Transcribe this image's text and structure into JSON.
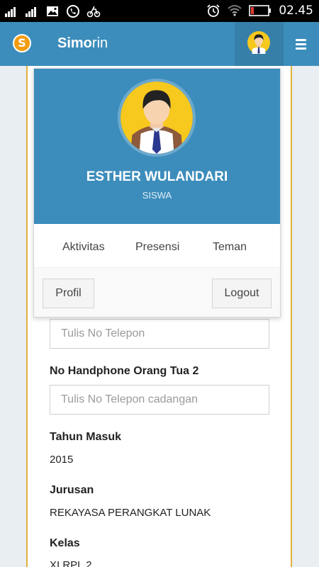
{
  "status_bar": {
    "icons": [
      "signal-icon",
      "signal-2-icon",
      "image-icon",
      "whatsapp-icon",
      "bike-icon",
      "alarm-icon",
      "wifi-icon",
      "battery-icon"
    ],
    "time": "02.45"
  },
  "header": {
    "logo_letter": "S",
    "brand_bold": "Simo",
    "brand_rest": "rin",
    "colors": {
      "primary": "#3c8dbc",
      "primary_dark": "#367fa9",
      "logo": "#f39c12"
    }
  },
  "user_menu": {
    "name": "ESTHER WULANDARI",
    "role": "SISWA",
    "links": [
      "Aktivitas",
      "Presensi",
      "Teman"
    ],
    "profile_button": "Profil",
    "logout_button": "Logout"
  },
  "form": {
    "phone_placeholder": "Tulis No Telepon",
    "parent_phone2_label": "No Handphone Orang Tua 2",
    "parent_phone2_placeholder": "Tulis No Telepon cadangan",
    "year_label": "Tahun Masuk",
    "year_value": "2015",
    "major_label": "Jurusan",
    "major_value": "REKAYASA PERANGKAT LUNAK",
    "class_label": "Kelas",
    "class_value": "XI RPL 2"
  }
}
